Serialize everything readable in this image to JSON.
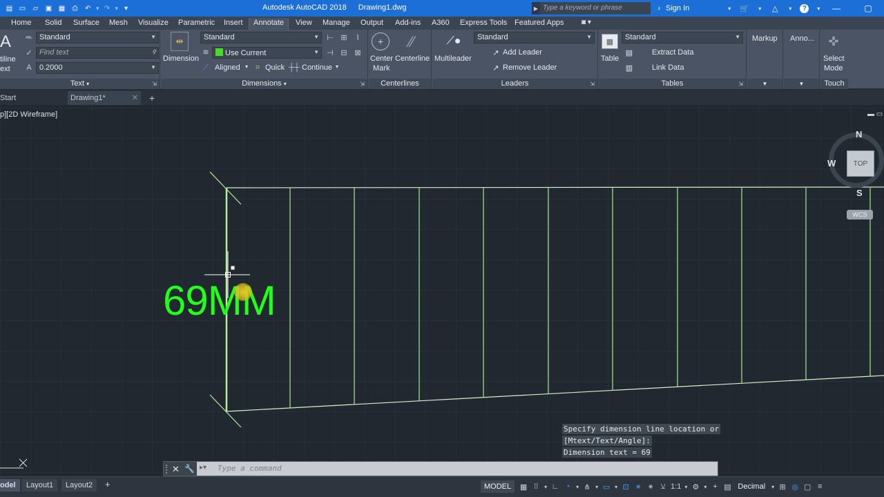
{
  "titlebar": {
    "app_name": "Autodesk AutoCAD 2018",
    "file_name": "Drawing1.dwg",
    "search_placeholder": "Type a keyword or phrase",
    "sign_in": "Sign In",
    "accent": "#1c6fd6"
  },
  "menu_tabs": [
    "Home",
    "Solid",
    "Surface",
    "Mesh",
    "Visualize",
    "Parametric",
    "Insert",
    "Annotate",
    "View",
    "Manage",
    "Output",
    "Add-ins",
    "A360",
    "Express Tools",
    "Featured Apps"
  ],
  "active_tab": "Annotate",
  "ribbon": {
    "text_panel": {
      "big_label_1": "tiline",
      "big_label_2": "ext",
      "style_value": "Standard",
      "find_placeholder": "Find text",
      "height_value": "0.2000",
      "title": "Text"
    },
    "dim_panel": {
      "dimension_label": "Dimension",
      "style_value": "Standard",
      "layer_value": "Use Current",
      "aligned": "Aligned",
      "quick": "Quick",
      "continue": "Continue",
      "title": "Dimensions"
    },
    "centerlines_panel": {
      "center_mark_1": "Center",
      "center_mark_2": "Mark",
      "centerline": "Centerline",
      "title": "Centerlines"
    },
    "leaders_panel": {
      "multileader": "Multileader",
      "style_value": "Standard",
      "add_leader": "Add Leader",
      "remove_leader": "Remove Leader",
      "title": "Leaders"
    },
    "tables_panel": {
      "table": "Table",
      "style_value": "Standard",
      "extract_data": "Extract Data",
      "link_data": "Link Data",
      "title": "Tables"
    },
    "markup_panel": {
      "label": "Markup"
    },
    "anno_panel": {
      "label": "Anno..."
    },
    "touch_panel": {
      "label_1": "Select",
      "label_2": "Mode",
      "title": "Touch"
    }
  },
  "file_tabs": {
    "start": "Start",
    "drawing": "Drawing1*"
  },
  "viewport": {
    "label": "p][2D Wireframe]",
    "dimension_text": "69MM",
    "dimension_color": "#22ff1a",
    "line_color": "#a8e890"
  },
  "viewcube": {
    "north": "N",
    "west": "W",
    "south": "S",
    "top": "TOP",
    "wcs": "WCS"
  },
  "command": {
    "history": [
      "Specify dimension line location or",
      "[Mtext/Text/Angle]:",
      "Dimension text = 69"
    ],
    "placeholder": "Type a command"
  },
  "layout_tabs": [
    "odel",
    "Layout1",
    "Layout2"
  ],
  "status": {
    "model": "MODEL",
    "scale": "1:1",
    "units": "Decimal"
  }
}
